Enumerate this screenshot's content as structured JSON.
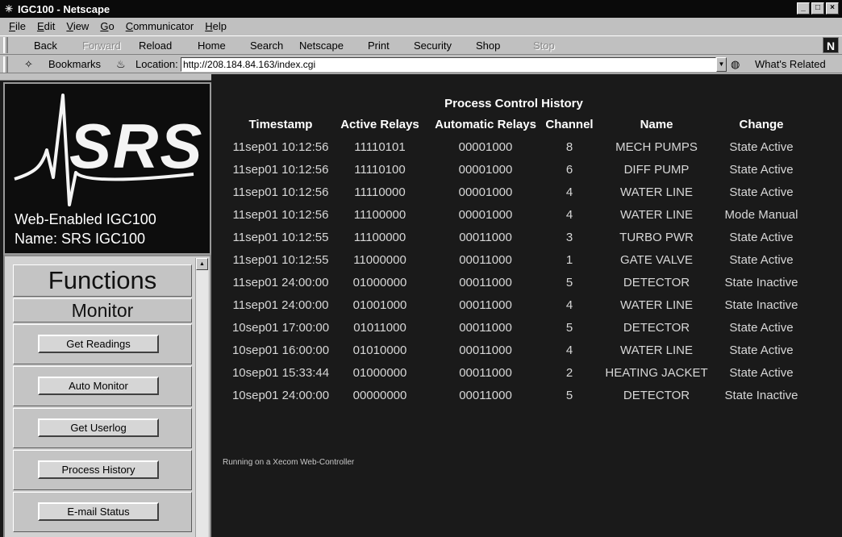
{
  "window": {
    "title": "IGC100 - Netscape"
  },
  "menu": [
    "File",
    "Edit",
    "View",
    "Go",
    "Communicator",
    "Help"
  ],
  "toolbar": {
    "back": "Back",
    "forward": "Forward",
    "reload": "Reload",
    "home": "Home",
    "search": "Search",
    "netscape": "Netscape",
    "print": "Print",
    "security": "Security",
    "shop": "Shop",
    "stop": "Stop"
  },
  "location": {
    "bookmarks": "Bookmarks",
    "label": "Location:",
    "url": "http://208.184.84.163/index.cgi",
    "related": "What's Related"
  },
  "device": {
    "logo_text": "SRS",
    "title": "Web-Enabled IGC100",
    "name": "Name: SRS IGC100"
  },
  "functions": {
    "heading": "Functions",
    "section": "Monitor",
    "buttons": [
      "Get Readings",
      "Auto Monitor",
      "Get Userlog",
      "Process History",
      "E-mail Status"
    ]
  },
  "history": {
    "title": "Process Control History",
    "columns": [
      "Timestamp",
      "Active Relays",
      "Automatic Relays",
      "Channel",
      "Name",
      "Change"
    ],
    "rows": [
      [
        "11sep01 10:12:56",
        "11110101",
        "00001000",
        "8",
        "MECH PUMPS",
        "State Active"
      ],
      [
        "11sep01 10:12:56",
        "11110100",
        "00001000",
        "6",
        "DIFF PUMP",
        "State Active"
      ],
      [
        "11sep01 10:12:56",
        "11110000",
        "00001000",
        "4",
        "WATER LINE",
        "State Active"
      ],
      [
        "11sep01 10:12:56",
        "11100000",
        "00001000",
        "4",
        "WATER LINE",
        "Mode Manual"
      ],
      [
        "11sep01 10:12:55",
        "11100000",
        "00011000",
        "3",
        "TURBO PWR",
        "State Active"
      ],
      [
        "11sep01 10:12:55",
        "11000000",
        "00011000",
        "1",
        "GATE VALVE",
        "State Active"
      ],
      [
        "11sep01 24:00:00",
        "01000000",
        "00011000",
        "5",
        "DETECTOR",
        "State Inactive"
      ],
      [
        "11sep01 24:00:00",
        "01001000",
        "00011000",
        "4",
        "WATER LINE",
        "State Inactive"
      ],
      [
        "10sep01 17:00:00",
        "01011000",
        "00011000",
        "5",
        "DETECTOR",
        "State Active"
      ],
      [
        "10sep01 16:00:00",
        "01010000",
        "00011000",
        "4",
        "WATER LINE",
        "State Active"
      ],
      [
        "10sep01 15:33:44",
        "01000000",
        "00011000",
        "2",
        "HEATING JACKET",
        "State Active"
      ],
      [
        "10sep01 24:00:00",
        "00000000",
        "00011000",
        "5",
        "DETECTOR",
        "State Inactive"
      ]
    ],
    "footer": "Running on a Xecom Web-Controller"
  }
}
